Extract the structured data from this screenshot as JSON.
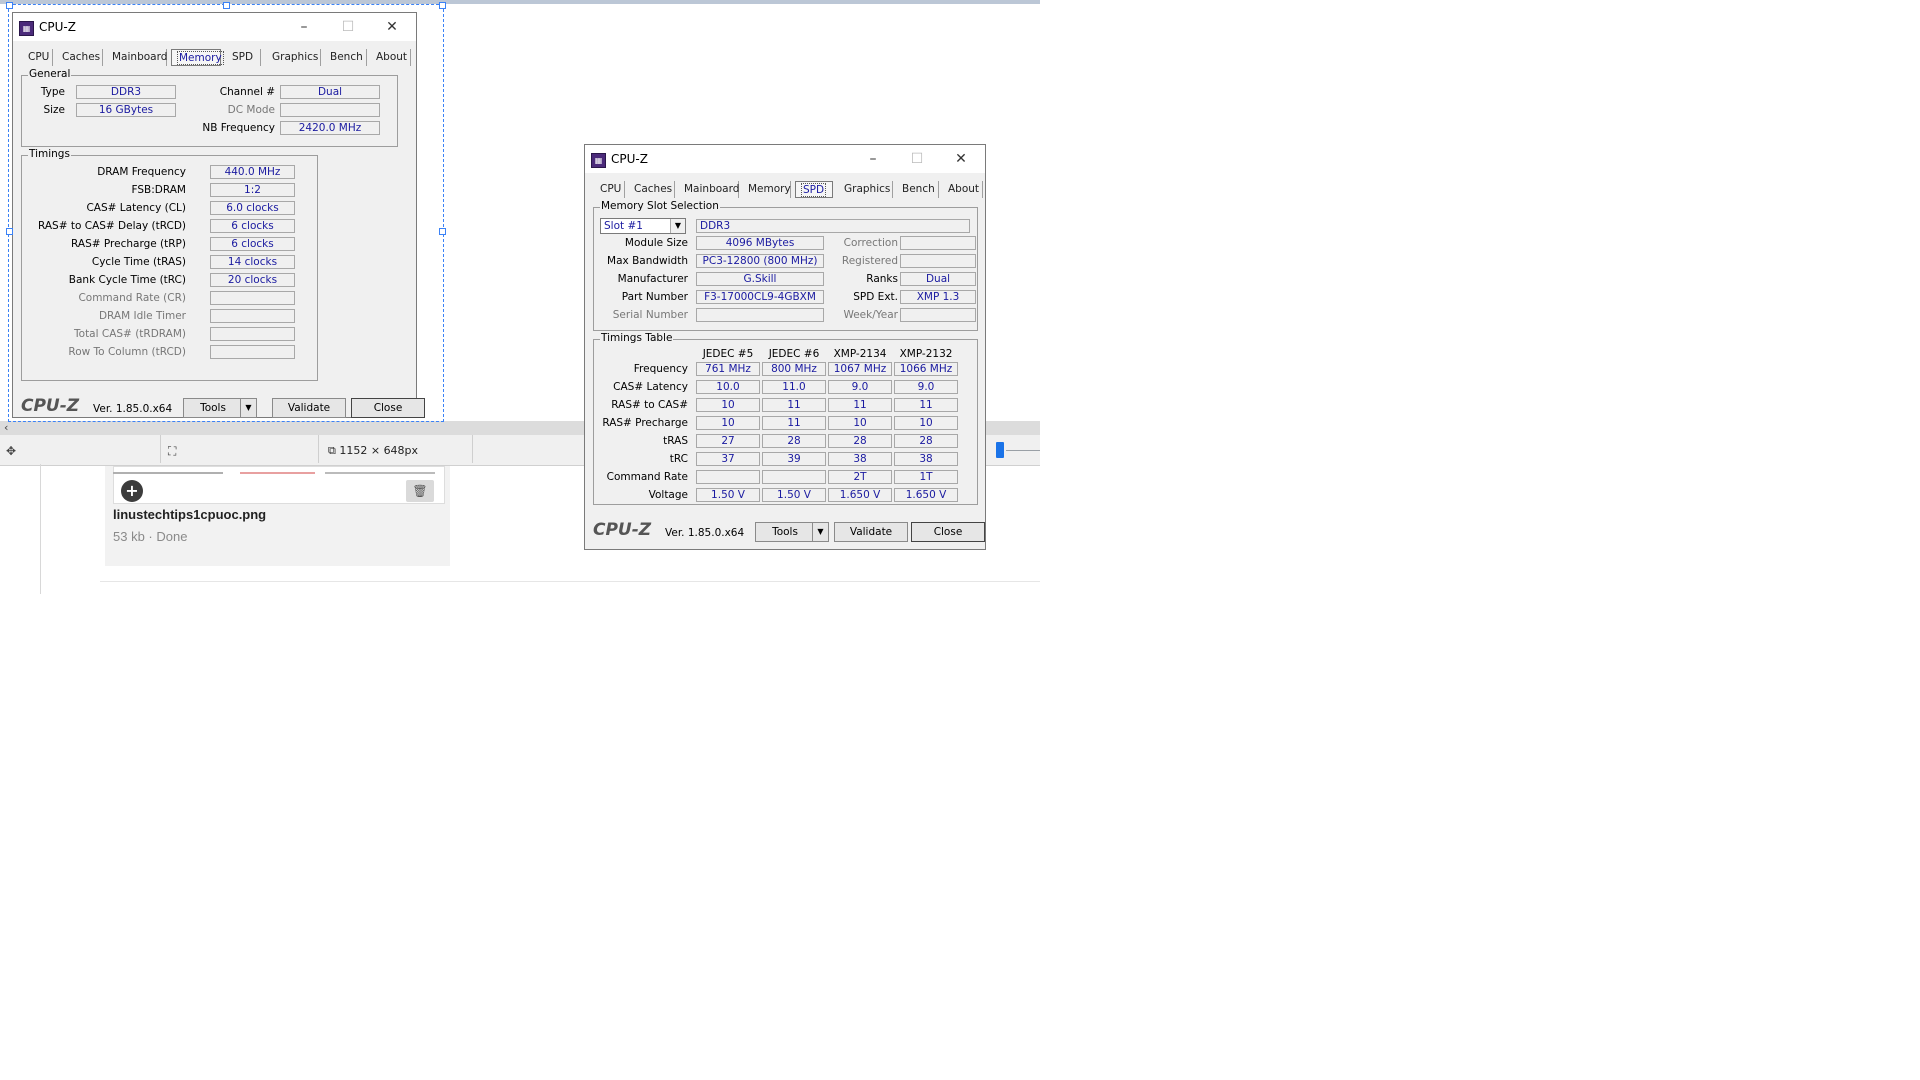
{
  "editor": {
    "dimensions": "1152 × 648px",
    "file_name": "linustechtips1cpuoc.png",
    "file_status": "53 kb · Done"
  },
  "win_left": {
    "title": "CPU-Z",
    "tabs": [
      "CPU",
      "Caches",
      "Mainboard",
      "Memory",
      "SPD",
      "Graphics",
      "Bench",
      "About"
    ],
    "active_tab": "Memory",
    "general": {
      "label": "General",
      "type_label": "Type",
      "type": "DDR3",
      "size_label": "Size",
      "size": "16 GBytes",
      "channel_label": "Channel #",
      "channel": "Dual",
      "dcmode_label": "DC Mode",
      "dcmode": "",
      "nbfreq_label": "NB Frequency",
      "nbfreq": "2420.0 MHz"
    },
    "timings": {
      "label": "Timings",
      "rows": [
        {
          "label": "DRAM Frequency",
          "value": "440.0 MHz",
          "dim": false
        },
        {
          "label": "FSB:DRAM",
          "value": "1:2",
          "dim": false
        },
        {
          "label": "CAS# Latency (CL)",
          "value": "6.0 clocks",
          "dim": false
        },
        {
          "label": "RAS# to CAS# Delay (tRCD)",
          "value": "6 clocks",
          "dim": false
        },
        {
          "label": "RAS# Precharge (tRP)",
          "value": "6 clocks",
          "dim": false
        },
        {
          "label": "Cycle Time (tRAS)",
          "value": "14 clocks",
          "dim": false
        },
        {
          "label": "Bank Cycle Time (tRC)",
          "value": "20 clocks",
          "dim": false
        },
        {
          "label": "Command Rate (CR)",
          "value": "",
          "dim": true
        },
        {
          "label": "DRAM Idle Timer",
          "value": "",
          "dim": true
        },
        {
          "label": "Total CAS# (tRDRAM)",
          "value": "",
          "dim": true
        },
        {
          "label": "Row To Column (tRCD)",
          "value": "",
          "dim": true
        }
      ]
    },
    "footer": {
      "logo": "CPU-Z",
      "version": "Ver. 1.85.0.x64",
      "tools": "Tools",
      "validate": "Validate",
      "close": "Close"
    }
  },
  "win_right": {
    "title": "CPU-Z",
    "tabs": [
      "CPU",
      "Caches",
      "Mainboard",
      "Memory",
      "SPD",
      "Graphics",
      "Bench",
      "About"
    ],
    "active_tab": "SPD",
    "slot": {
      "label": "Memory Slot Selection",
      "selected": "Slot #1",
      "type": "DDR3",
      "module_size_label": "Module Size",
      "module_size": "4096 MBytes",
      "max_bw_label": "Max Bandwidth",
      "max_bw": "PC3-12800 (800 MHz)",
      "manufacturer_label": "Manufacturer",
      "manufacturer": "G.Skill",
      "part_label": "Part Number",
      "part": "F3-17000CL9-4GBXM",
      "serial_label": "Serial Number",
      "serial": "",
      "correction_label": "Correction",
      "correction": "",
      "registered_label": "Registered",
      "registered": "",
      "ranks_label": "Ranks",
      "ranks": "Dual",
      "spdext_label": "SPD Ext.",
      "spdext": "XMP 1.3",
      "weekyear_label": "Week/Year",
      "weekyear": ""
    },
    "timings_table": {
      "label": "Timings Table",
      "columns": [
        "JEDEC #5",
        "JEDEC #6",
        "XMP-2134",
        "XMP-2132"
      ],
      "rows": [
        {
          "label": "Frequency",
          "values": [
            "761 MHz",
            "800 MHz",
            "1067 MHz",
            "1066 MHz"
          ]
        },
        {
          "label": "CAS# Latency",
          "values": [
            "10.0",
            "11.0",
            "9.0",
            "9.0"
          ]
        },
        {
          "label": "RAS# to CAS#",
          "values": [
            "10",
            "11",
            "11",
            "11"
          ]
        },
        {
          "label": "RAS# Precharge",
          "values": [
            "10",
            "11",
            "10",
            "10"
          ]
        },
        {
          "label": "tRAS",
          "values": [
            "27",
            "28",
            "28",
            "28"
          ]
        },
        {
          "label": "tRC",
          "values": [
            "37",
            "39",
            "38",
            "38"
          ]
        },
        {
          "label": "Command Rate",
          "values": [
            "",
            "",
            "2T",
            "1T"
          ]
        },
        {
          "label": "Voltage",
          "values": [
            "1.50 V",
            "1.50 V",
            "1.650 V",
            "1.650 V"
          ]
        }
      ]
    },
    "footer": {
      "logo": "CPU-Z",
      "version": "Ver. 1.85.0.x64",
      "tools": "Tools",
      "validate": "Validate",
      "close": "Close"
    }
  }
}
